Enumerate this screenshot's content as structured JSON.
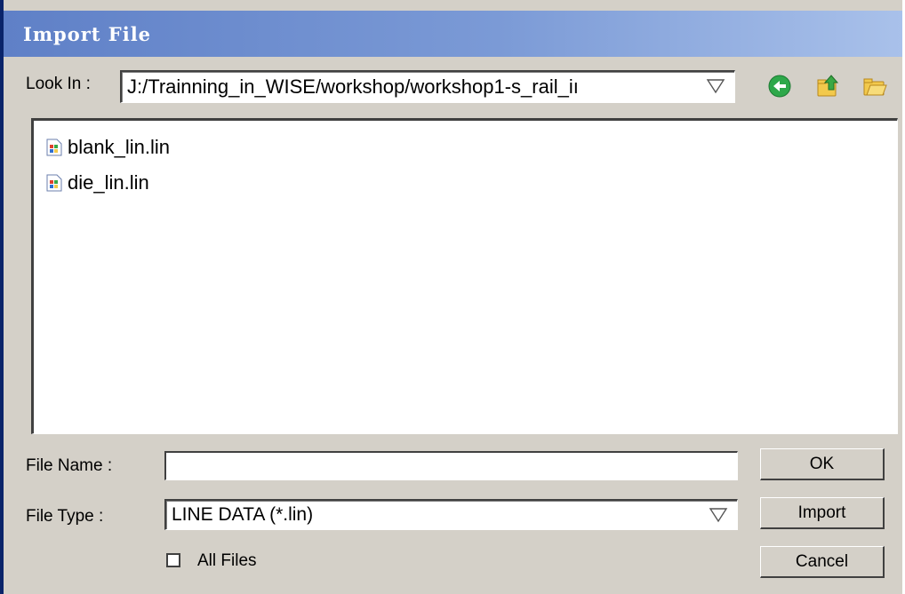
{
  "window": {
    "title": "Import File"
  },
  "look_in": {
    "label": "Look In :",
    "path": "J:/Trainning_in_WISE/workshop/workshop1-s_rail_iı"
  },
  "toolbar": {
    "icons": [
      "back-icon",
      "up-folder-icon",
      "new-folder-icon"
    ]
  },
  "files": [
    {
      "name": "blank_lin.lin",
      "icon": "file-icon"
    },
    {
      "name": "die_lin.lin",
      "icon": "file-icon"
    }
  ],
  "file_name": {
    "label": "File Name :",
    "value": ""
  },
  "file_type": {
    "label": "File Type :",
    "value": "LINE DATA (*.lin)"
  },
  "all_files": {
    "label": "All  Files",
    "checked": false
  },
  "buttons": {
    "ok": "OK",
    "import": "Import",
    "cancel": "Cancel"
  },
  "colors": {
    "title_bar_start": "#5f80c7",
    "title_bar_end": "#a9c1ea",
    "dialog_bg": "#d4d0c8"
  }
}
